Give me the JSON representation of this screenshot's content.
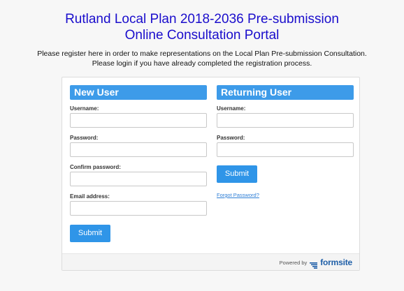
{
  "header": {
    "title_line1": "Rutland Local Plan 2018-2036 Pre-submission",
    "title_line2": "Online Consultation Portal",
    "intro_line1": "Please register here in order to make representations on the Local Plan Pre-submission Consultation.",
    "intro_line2": "Please login if you have already completed the registration process."
  },
  "new_user": {
    "heading": "New User",
    "username_label": "Username:",
    "password_label": "Password:",
    "confirm_password_label": "Confirm password:",
    "email_label": "Email address:",
    "username_value": "",
    "password_value": "",
    "confirm_password_value": "",
    "email_value": "",
    "submit_label": "Submit"
  },
  "returning_user": {
    "heading": "Returning User",
    "username_label": "Username:",
    "password_label": "Password:",
    "username_value": "",
    "password_value": "",
    "submit_label": "Submit",
    "forgot_password_label": "Forgot Password?"
  },
  "footer": {
    "powered_by": "Powered by",
    "brand_name": "formsite",
    "brand_icon": "formsite-logo-icon"
  },
  "colors": {
    "title": "#1a0dcc",
    "accent": "#3d9be9",
    "button": "#2f95e8",
    "link": "#2f7fd6",
    "brand": "#1f5fa8"
  }
}
